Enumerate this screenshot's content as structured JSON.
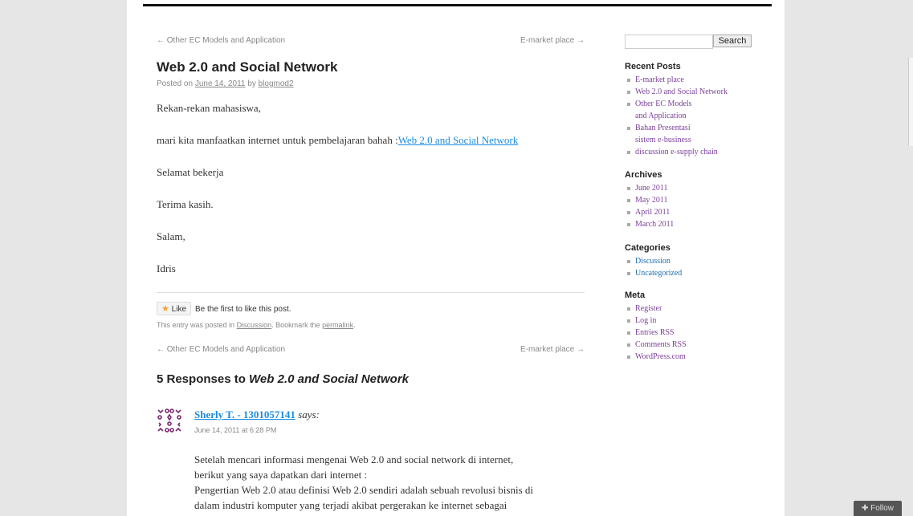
{
  "nav": {
    "prev": "← Other EC Models and Application",
    "next": "E-market place →"
  },
  "post": {
    "title": "Web 2.0 and Social Network",
    "meta_prefix": "Posted on",
    "date": "June 14, 2011",
    "meta_by": "by",
    "author": "blogmod2",
    "p1": "Rekan-rekan mahasiswa,",
    "p2_text": "mari kita manfaatkan internet untuk pembelajaran bahah :",
    "p2_link": "Web 2.0 and Social Network",
    "p3": "Selamat bekerja",
    "p4": "Terima kasih.",
    "p5": "Salam,",
    "p6": "Idris"
  },
  "like": {
    "button": "Like",
    "text": "Be the first to like this post."
  },
  "entry_util": {
    "prefix": "This entry was posted in",
    "category": "Discussion",
    "middle": ". Bookmark the",
    "permalink": "permalink",
    "suffix": "."
  },
  "responses": {
    "prefix": "5 Responses to",
    "title": "Web 2.0 and Social Network"
  },
  "comment": {
    "author": "Sherly T. - 1301057141",
    "says": "says:",
    "date": "June 14, 2011 at 6:28 PM",
    "line1": "Setelah mencari informasi mengenai Web 2.0 and social network di internet,",
    "line2": "berikut yang saya dapatkan dari internet :",
    "line3": "Pengertian Web 2.0 atau definisi Web 2.0 sendiri adalah sebuah revolusi bisnis di",
    "line4": "dalam industri komputer yang terjadi akibat pergerakan ke internet sebagai"
  },
  "sidebar": {
    "search_button": "Search",
    "recent_title": "Recent Posts",
    "recent": [
      "E-market place",
      "Web 2.0 and Social Network",
      "Other EC Models",
      "and Application",
      "Bahan Presentasi",
      "sistem e-business",
      "discussion e-supply chain"
    ],
    "archives_title": "Archives",
    "archives": [
      "June 2011",
      "May 2011",
      "April 2011",
      "March 2011"
    ],
    "categories_title": "Categories",
    "categories": [
      "Discussion",
      "Uncategorized"
    ],
    "meta_title": "Meta",
    "meta": [
      "Register",
      "Log in",
      "Entries RSS",
      "Comments RSS",
      "WordPress.com"
    ]
  },
  "follow": "Follow",
  "colors": {
    "link": "#1b8be0",
    "sidebar_link": "#7a3f9a",
    "title": "#222222"
  }
}
